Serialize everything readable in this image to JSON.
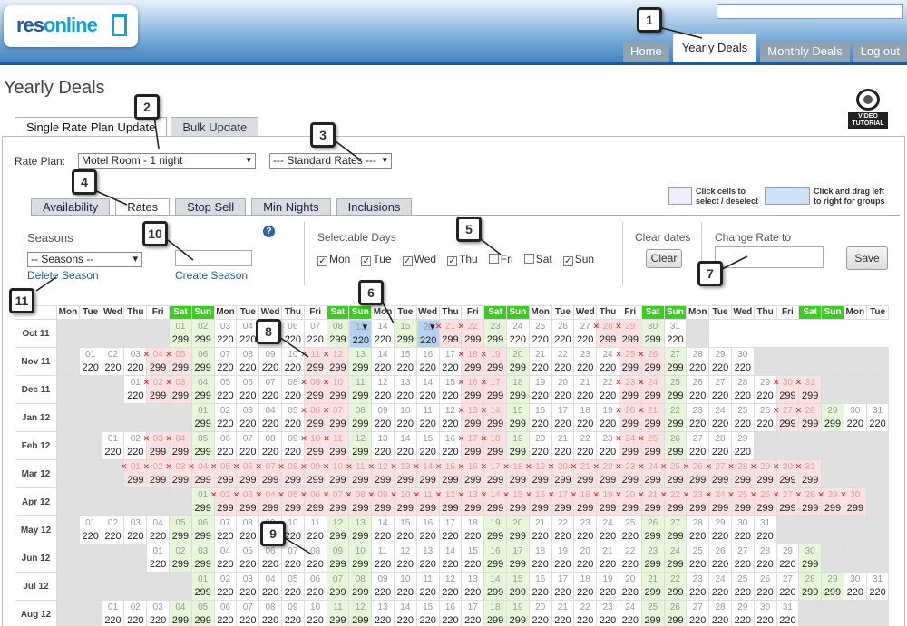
{
  "header": {
    "logo_res": "res",
    "logo_online": "online"
  },
  "nav": {
    "tabs": [
      {
        "label": "Home",
        "active": false
      },
      {
        "label": "Yearly Deals",
        "active": true
      },
      {
        "label": "Monthly Deals",
        "active": false
      },
      {
        "label": "Log out",
        "active": false
      }
    ]
  },
  "page_title": "Yearly Deals",
  "video_label": "VIDEO TUTORIAL",
  "mode_tabs": [
    {
      "label": "Single Rate Plan Update",
      "active": true
    },
    {
      "label": "Bulk Update",
      "active": false
    }
  ],
  "rate_plan": {
    "label": "Rate Plan:",
    "value": "Motel Room - 1 night",
    "rates_value": "--- Standard Rates ---"
  },
  "sub_tabs": [
    {
      "label": "Availability",
      "active": false
    },
    {
      "label": "Rates",
      "active": true
    },
    {
      "label": "Stop Sell",
      "active": false
    },
    {
      "label": "Min Nights",
      "active": false
    },
    {
      "label": "Inclusions",
      "active": false
    }
  ],
  "hints": {
    "select": "Click cells to\nselect / deselect",
    "drag": "Click and drag left\nto right for groups"
  },
  "seasons": {
    "title": "Seasons",
    "select_value": "-- Seasons --",
    "delete_link": "Delete Season",
    "create_link": "Create Season"
  },
  "selectable_days": {
    "title": "Selectable Days",
    "days": [
      {
        "label": "Mon",
        "checked": true
      },
      {
        "label": "Tue",
        "checked": true
      },
      {
        "label": "Wed",
        "checked": true
      },
      {
        "label": "Thu",
        "checked": true
      },
      {
        "label": "Fri",
        "checked": false
      },
      {
        "label": "Sat",
        "checked": false
      },
      {
        "label": "Sun",
        "checked": true
      }
    ]
  },
  "clear_dates": {
    "title": "Clear dates",
    "button": "Clear"
  },
  "change_rate": {
    "title": "Change Rate to",
    "button": "Save"
  },
  "calendar": {
    "day_headers": [
      "Mon",
      "Tue",
      "Wed",
      "Thu",
      "Fri",
      "Sat",
      "Sun",
      "Mon",
      "Tue",
      "Wed",
      "Thu",
      "Fri",
      "Sat",
      "Sun",
      "Mon",
      "Tue",
      "Wed",
      "Thu",
      "Fri",
      "Sat",
      "Sun",
      "Mon",
      "Tue",
      "Wed",
      "Thu",
      "Fri",
      "Sat",
      "Sun",
      "Mon",
      "Tue",
      "Wed",
      "Thu",
      "Fri",
      "Sat",
      "Sun",
      "Mon",
      "Tue"
    ],
    "months": [
      {
        "label": "Oct 11",
        "offset": 5,
        "days": 31,
        "stop": [
          21,
          22,
          28,
          29
        ],
        "selected": [
          9,
          10,
          11,
          12,
          13,
          16,
          17,
          18,
          19,
          20
        ]
      },
      {
        "label": "Nov 11",
        "offset": 1,
        "days": 30,
        "stop": [
          4,
          5,
          11,
          12,
          18,
          19,
          25,
          26
        ]
      },
      {
        "label": "Dec 11",
        "offset": 3,
        "days": 31,
        "stop": [
          2,
          3,
          9,
          10,
          16,
          17,
          23,
          24,
          30,
          31
        ]
      },
      {
        "label": "Jan 12",
        "offset": 6,
        "days": 31,
        "stop": [
          6,
          7,
          13,
          14,
          20,
          21,
          27,
          28
        ]
      },
      {
        "label": "Feb 12",
        "offset": 2,
        "days": 29,
        "stop": [
          3,
          4,
          10,
          11,
          17,
          18,
          24,
          25
        ]
      },
      {
        "label": "Mar 12",
        "offset": 3,
        "days": 31,
        "stop": [
          1,
          2,
          3,
          4,
          5,
          6,
          7,
          8,
          9,
          10,
          11,
          12,
          13,
          14,
          15,
          16,
          17,
          18,
          19,
          20,
          21,
          22,
          23,
          24,
          25,
          26,
          27,
          28,
          29,
          30,
          31
        ]
      },
      {
        "label": "Apr 12",
        "offset": 6,
        "days": 30,
        "stop": [
          2,
          3,
          4,
          5,
          6,
          7,
          8,
          9,
          10,
          11,
          12,
          13,
          14,
          15,
          16,
          17,
          18,
          19,
          20,
          21,
          22,
          23,
          24,
          25,
          26,
          27,
          28,
          29,
          30
        ]
      },
      {
        "label": "May 12",
        "offset": 1,
        "days": 31,
        "stop": []
      },
      {
        "label": "Jun 12",
        "offset": 4,
        "days": 30,
        "stop": []
      },
      {
        "label": "Jul 12",
        "offset": 6,
        "days": 31,
        "stop": []
      },
      {
        "label": "Aug 12",
        "offset": 2,
        "days": 31,
        "stop": []
      }
    ]
  },
  "callouts": [
    "1",
    "2",
    "3",
    "4",
    "5",
    "6",
    "7",
    "8",
    "9",
    "10",
    "11"
  ]
}
